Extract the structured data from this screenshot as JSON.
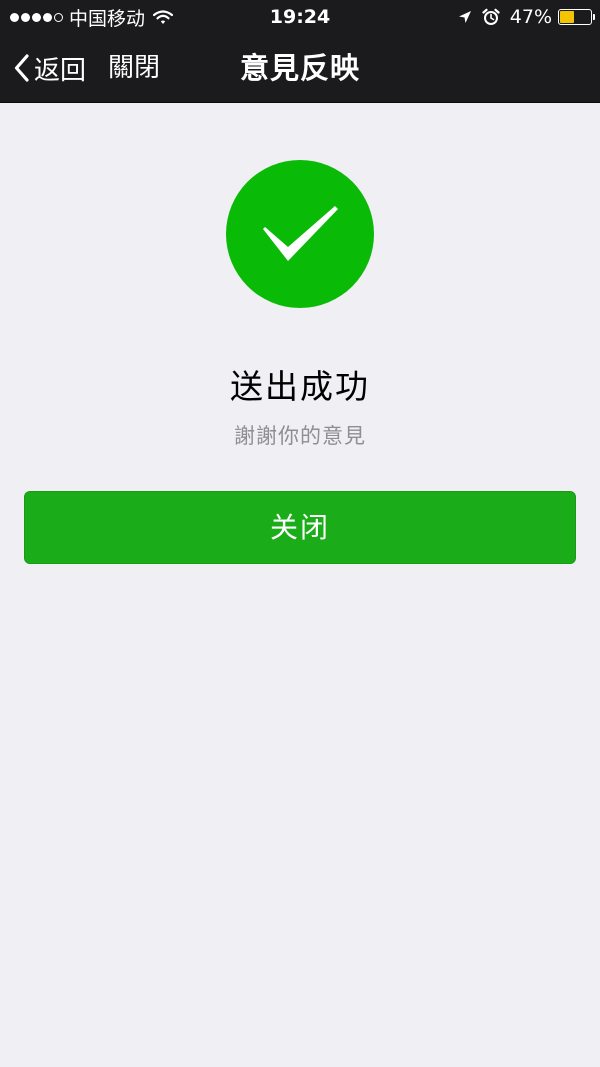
{
  "status_bar": {
    "signal_dots_filled": 4,
    "signal_dots_total": 5,
    "carrier": "中国移动",
    "wifi_icon": "wifi-icon",
    "time": "19:24",
    "location_icon": "location-arrow-icon",
    "alarm_icon": "alarm-clock-icon",
    "battery_percent": "47%",
    "battery_level": 0.47,
    "battery_color": "#f5c400"
  },
  "nav": {
    "back_label": "返回",
    "close_label": "關閉",
    "title": "意見反映"
  },
  "result": {
    "icon": "success-check-icon",
    "icon_color": "#09bb07",
    "title": "送出成功",
    "description": "謝謝你的意見"
  },
  "actions": {
    "close_button_label": "关闭",
    "button_color": "#1aad19"
  }
}
